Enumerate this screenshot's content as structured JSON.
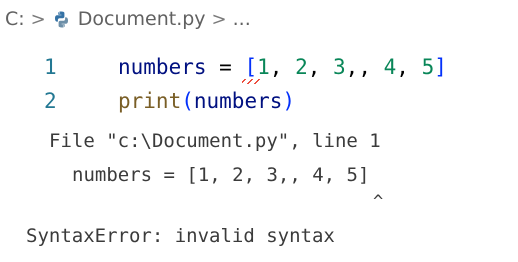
{
  "breadcrumb": {
    "drive": "C:",
    "separator": ">",
    "file_name": "Document.py",
    "file_icon": "python-file-icon",
    "trailing": "..."
  },
  "editor": {
    "lines": [
      {
        "number": "1",
        "tokens": [
          "numbers",
          " = ",
          "[",
          "1",
          ", ",
          "2",
          ", ",
          "3",
          ",, ",
          "4",
          ", ",
          "5",
          "]"
        ]
      },
      {
        "number": "2",
        "tokens": [
          "print",
          "(",
          "numbers",
          ")"
        ]
      }
    ]
  },
  "terminal_output": {
    "file_line": "File \"c:\\Document.py\", line 1",
    "code_line": "numbers = [1, 2, 3,, 4, 5]",
    "caret_line": "^",
    "error_line": "SyntaxError: invalid syntax"
  },
  "colors": {
    "line_number": "#237893",
    "variable": "#001080",
    "number": "#098658",
    "function": "#795e26",
    "bracket_level_1": "#0431fa",
    "error_squiggle": "#e51400",
    "output_text": "#3b3b3b"
  }
}
